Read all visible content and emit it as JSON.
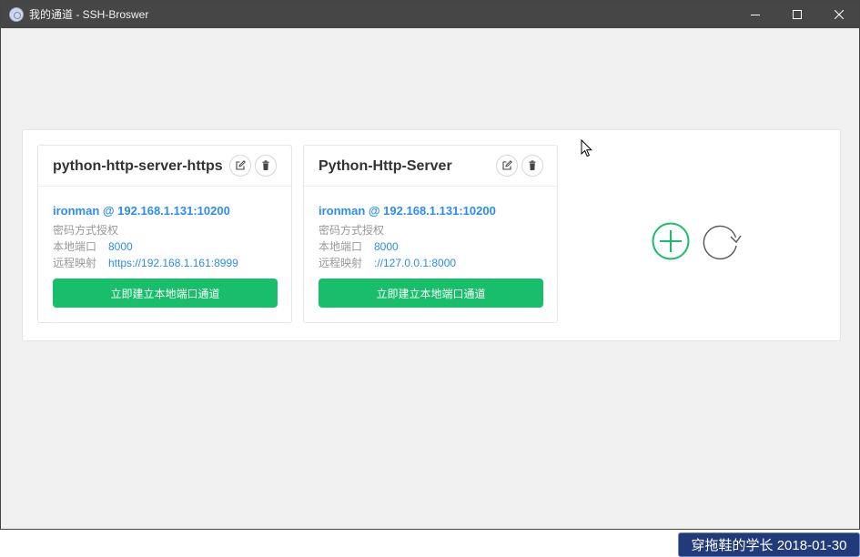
{
  "window": {
    "title": "我的通道 - SSH-Broswer"
  },
  "tunnels": [
    {
      "name": "python-http-server-https",
      "host": "ironman @ 192.168.1.131:10200",
      "auth": "密码方式授权",
      "local_label": "本地端口",
      "local_port": "8000",
      "remote_label": "远程映射",
      "remote": "https://192.168.1.161:8999",
      "open_label": "立即建立本地端口通道"
    },
    {
      "name": "Python-Http-Server",
      "host": "ironman @ 192.168.1.131:10200",
      "auth": "密码方式授权",
      "local_label": "本地端口",
      "local_port": "8000",
      "remote_label": "远程映射",
      "remote": "://127.0.0.1:8000",
      "open_label": "立即建立本地端口通道"
    }
  ],
  "icons": {
    "edit": "edit-icon",
    "delete": "trash-icon",
    "add": "plus-circle-icon",
    "refresh": "refresh-icon"
  },
  "colors": {
    "accent": "#2d8cf0",
    "success": "#19be6b",
    "titlebar": "#464646"
  },
  "watermark": "穿拖鞋的学长 2018-01-30"
}
